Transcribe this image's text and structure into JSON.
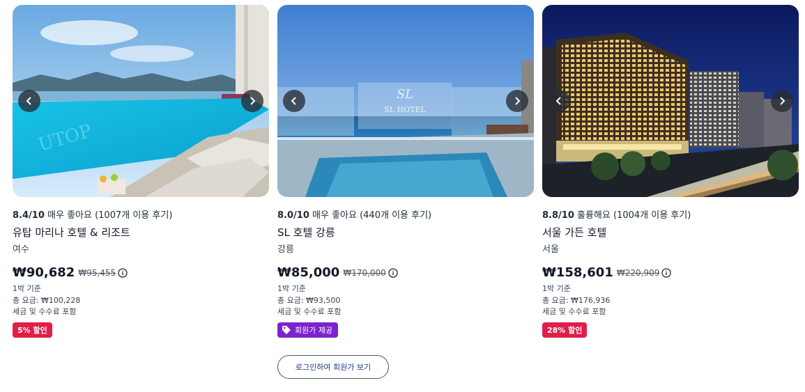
{
  "hotels": [
    {
      "score": "8.4/10",
      "rating_text": "매우 좋아요",
      "reviews": "(1007개 이용 후기)",
      "name": "유탑 마리나 호텔 & 리조트",
      "city": "여수",
      "price": "₩90,682",
      "old_price": "₩95,455",
      "per_night": "1박 기준",
      "total": "총 요금: ₩100,228",
      "taxes": "세금 및 수수료 포함",
      "badge": "5% 할인",
      "photo_sign": "UTOP"
    },
    {
      "score": "8.0/10",
      "rating_text": "매우 좋아요",
      "reviews": "(440개 이용 후기)",
      "name": "SL 호텔 강릉",
      "city": "강릉",
      "price": "₩85,000",
      "old_price": "₩170,000",
      "per_night": "1박 기준",
      "total": "총 요금: ₩93,500",
      "taxes": "세금 및 수수료 포함",
      "badge": "회원가 제공",
      "login_button": "로그인하여 회원가 보기",
      "photo_sign": "SL HOTEL"
    },
    {
      "score": "8.8/10",
      "rating_text": "훌륭해요",
      "reviews": "(1004개 이용 후기)",
      "name": "서울 가든 호텔",
      "city": "서울",
      "price": "₩158,601",
      "old_price": "₩220,909",
      "per_night": "1박 기준",
      "total": "총 요금: ₩176,936",
      "taxes": "세금 및 수수료 포함",
      "badge": "28% 할인"
    }
  ],
  "icons": {
    "prev": "chevron-left-icon",
    "next": "chevron-right-icon",
    "info": "info-icon",
    "tag": "tag-icon"
  },
  "colors": {
    "sale_badge": "#e11d48",
    "member_badge": "#7e22ce",
    "login_text": "#1e3a8a"
  }
}
